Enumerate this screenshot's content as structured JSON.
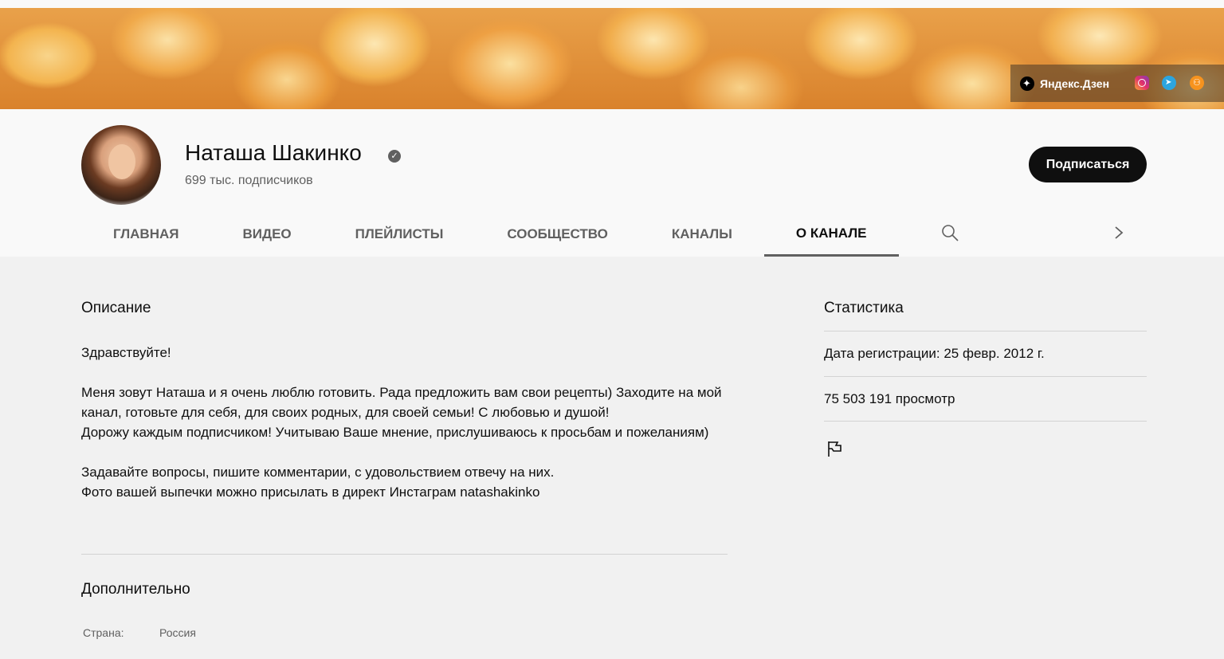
{
  "banner": {
    "social_links": [
      {
        "label": "Яндекс.Дзен",
        "icon": "yandex-dzen-icon"
      },
      {
        "label": "",
        "icon": "instagram-icon"
      },
      {
        "label": "",
        "icon": "telegram-icon"
      },
      {
        "label": "",
        "icon": "odnoklassniki-icon"
      }
    ]
  },
  "channel": {
    "name": "Наташа Шакинко",
    "verified": true,
    "subscribers": "699 тыс. подписчиков",
    "subscribe_label": "Подписаться"
  },
  "tabs": [
    {
      "label": "ГЛАВНАЯ",
      "active": false
    },
    {
      "label": "ВИДЕО",
      "active": false
    },
    {
      "label": "ПЛЕЙЛИСТЫ",
      "active": false
    },
    {
      "label": "СООБЩЕСТВО",
      "active": false
    },
    {
      "label": "КАНАЛЫ",
      "active": false
    },
    {
      "label": "О КАНАЛЕ",
      "active": true
    }
  ],
  "about": {
    "description_heading": "Описание",
    "description": "Здравствуйте!\n\nМеня зовут Наташа и я очень люблю готовить. Рада предложить вам свои рецепты) Заходите на мой канал, готовьте для себя, для своих родных, для своей семьи! С любовью и душой!\nДорожу каждым подписчиком! Учитываю Ваше мнение, прислушиваюсь к просьбам и пожеланиям)\n\nЗадавайте вопросы, пишите комментарии, с удовольствием отвечу на них.\nФото вашей выпечки можно присылать в директ Инстаграм natashakinko",
    "additional_heading": "Дополнительно",
    "country_label": "Страна:",
    "country_value": "Россия"
  },
  "stats": {
    "heading": "Статистика",
    "registered": "Дата регистрации: 25 февр. 2012 г.",
    "views": "75 503 191 просмотр",
    "report_icon": "flag-icon"
  },
  "colors": {
    "page_bg": "#f1f1f1",
    "header_bg": "#f9f9f9",
    "subscribe_bg": "#0f0f0f"
  }
}
